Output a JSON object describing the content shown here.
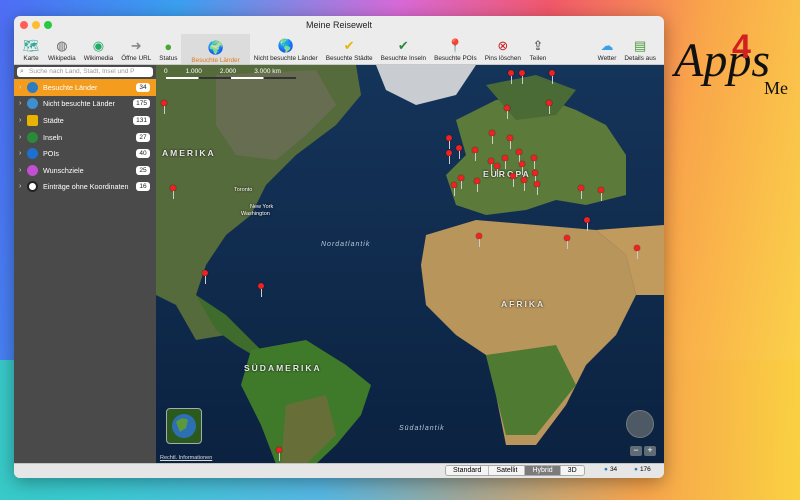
{
  "window": {
    "title": "Meine Reisewelt"
  },
  "toolbar": [
    {
      "label": "Karte",
      "icon": "map-icon"
    },
    {
      "label": "Wikipedia",
      "icon": "wikipedia-icon"
    },
    {
      "label": "Wikimedia",
      "icon": "wikimedia-icon"
    },
    {
      "label": "Öffne URL",
      "icon": "arrow-right-icon"
    },
    {
      "label": "Status",
      "icon": "status-globe-icon"
    },
    {
      "label": "Besuchte Länder",
      "icon": "visited-globe-icon",
      "active": true
    },
    {
      "label": "Nicht besuchte Länder",
      "icon": "globe-icon"
    },
    {
      "label": "Besuchte Städte",
      "icon": "city-check-icon"
    },
    {
      "label": "Besuchte Inseln",
      "icon": "island-check-icon"
    },
    {
      "label": "Besuchte POIs",
      "icon": "poi-check-icon"
    },
    {
      "label": "Pins löschen",
      "icon": "pin-delete-icon"
    },
    {
      "label": "Teilen",
      "icon": "share-icon"
    },
    {
      "label": "Wetter",
      "icon": "weather-icon"
    },
    {
      "label": "Details aus",
      "icon": "details-icon"
    }
  ],
  "search": {
    "placeholder": "Suche nach Land, Stadt, Insel und P"
  },
  "sidebar": {
    "items": [
      {
        "label": "Besuchte Länder",
        "count": "34",
        "icon": "visited-globe-icon",
        "selected": true
      },
      {
        "label": "Nicht besuchte Länder",
        "count": "175",
        "icon": "globe-icon"
      },
      {
        "label": "Städte",
        "count": "131",
        "icon": "city-icon"
      },
      {
        "label": "Inseln",
        "count": "27",
        "icon": "island-icon"
      },
      {
        "label": "POIs",
        "count": "40",
        "icon": "poi-icon"
      },
      {
        "label": "Wunschziele",
        "count": "25",
        "icon": "wish-icon"
      },
      {
        "label": "Einträge ohne Koordinaten",
        "count": "16",
        "icon": "location-pin-icon"
      }
    ]
  },
  "map": {
    "scale": [
      "0",
      "1.000",
      "2.000",
      "3.000 km"
    ],
    "regions": {
      "amerika": "AMERIKA",
      "europa": "EUROPA",
      "afrika": "AFRIKA",
      "suedamerika": "SÜDAMERIKA"
    },
    "oceans": {
      "north": "Nordatlantik",
      "south": "Südatlantik"
    },
    "cities": {
      "toronto": "Toronto",
      "newyork": "New York",
      "washington": "Washington"
    },
    "legal": "Rechtl. Informationen"
  },
  "statusbar": {
    "map_types": [
      "Standard",
      "Satellit",
      "Hybrid",
      "3D"
    ],
    "selected_map_type": "Hybrid",
    "visited_count": "34",
    "total_count": "176"
  },
  "brand": {
    "text": "Apps",
    "suffix": "Me",
    "number": "4"
  }
}
